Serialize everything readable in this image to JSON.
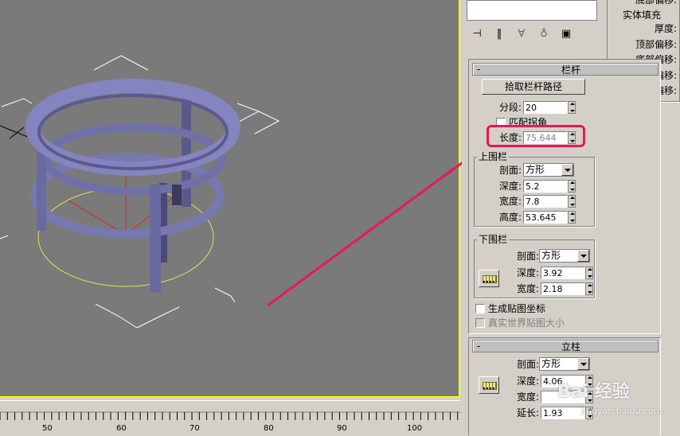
{
  "colors": {
    "viewport_bg": "#7a7a7a",
    "viewport_border": "#ffff00",
    "object": "#7f7fbf",
    "highlight": "#e8185a",
    "panel": "#d4d0c8"
  },
  "ruler": {
    "labels": [
      "50",
      "60",
      "70",
      "80",
      "90",
      "100"
    ]
  },
  "right_strip": {
    "top_item": "底部偏移:",
    "group_title": "实体填充",
    "labels": [
      "厚度:",
      "顶部偏移:",
      "底部偏移:",
      "左偏移:",
      "右偏移:"
    ]
  },
  "toolbar": {
    "icons": [
      "pin-stack-icon",
      "show-end-result-icon",
      "make-unique-icon",
      "remove-modifier-icon",
      "configure-sets-icon"
    ]
  },
  "railing": {
    "title": "栏杆",
    "minus": "-",
    "pick_path_label": "拾取栏杆路径",
    "segments_label": "分段:",
    "segments_value": "20",
    "match_corners_label": "匹配拐角",
    "length_label": "长度:",
    "length_value": "75.644",
    "top_rail": {
      "title": "上围栏",
      "profile_label": "剖面:",
      "profile_value": "方形",
      "depth_label": "深度:",
      "depth_value": "5.2",
      "width_label": "宽度:",
      "width_value": "7.8",
      "height_label": "高度:",
      "height_value": "53.645"
    },
    "lower_rail": {
      "title": "下围栏",
      "profile_label": "剖面:",
      "profile_value": "方形",
      "depth_label": "深度:",
      "depth_value": "3.92",
      "width_label": "宽度:",
      "width_value": "2.18"
    },
    "gen_mapping_label": "生成贴图坐标",
    "real_world_label": "真实世界贴图大小"
  },
  "posts": {
    "title": "立柱",
    "minus": "-",
    "profile_label": "剖面:",
    "profile_value": "方形",
    "depth_label": "深度:",
    "depth_value": "4.06",
    "width_label": "宽度:",
    "width_value": "",
    "extension_label": "延长:",
    "extension_value": "1.93"
  },
  "watermark": {
    "text": "Bai 经验",
    "url": "jingyan.baidu.com"
  }
}
